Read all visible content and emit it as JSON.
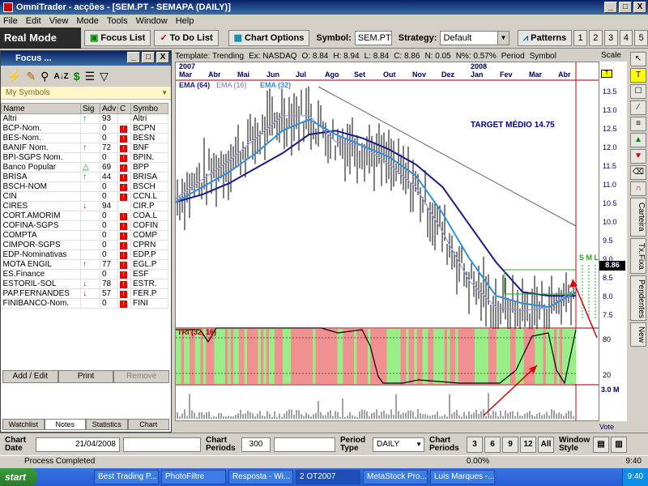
{
  "window": {
    "title": "OmniTrader - acções - [SEM.PT - SEMAPA (DAILY)]",
    "min": "_",
    "max": "□",
    "close": "X"
  },
  "menu": [
    "File",
    "Edit",
    "View",
    "Mode",
    "Tools",
    "Window",
    "Help"
  ],
  "toolbar": {
    "mode": "Real Mode",
    "focus_list": "Focus List",
    "todo_list": "To Do List",
    "chart_options": "Chart Options",
    "symbol_label": "Symbol:",
    "symbol_value": "SEM.PT",
    "strategy_label": "Strategy:",
    "strategy_value": "Default",
    "patterns": "Patterns",
    "pages": [
      "1",
      "2",
      "3",
      "4",
      "5"
    ]
  },
  "focus": {
    "title": "Focus ...",
    "list_name": "My Symbols",
    "columns": [
      "Name",
      "Sig",
      "Adv",
      "C",
      "Symbo"
    ],
    "rows": [
      {
        "name": "Altri",
        "sig": "up",
        "adv": "93",
        "c": "",
        "sym": "Altri"
      },
      {
        "name": "BCP-Nom.",
        "sig": "",
        "adv": "0",
        "c": "warn",
        "sym": "BCPN"
      },
      {
        "name": "BES-Nom.",
        "sig": "",
        "adv": "0",
        "c": "warn",
        "sym": "BESN"
      },
      {
        "name": "BANIF Nom.",
        "sig": "up",
        "adv": "72",
        "c": "warn",
        "sym": "BNF"
      },
      {
        "name": "BPI-SGPS Nom.",
        "sig": "",
        "adv": "0",
        "c": "warn",
        "sym": "BPIN."
      },
      {
        "name": "Banco Popular",
        "sig": "tri",
        "adv": "69",
        "c": "warn",
        "sym": "BPP"
      },
      {
        "name": "BRISA",
        "sig": "up",
        "adv": "44",
        "c": "warn",
        "sym": "BRISA"
      },
      {
        "name": "BSCH-NOM",
        "sig": "",
        "adv": "0",
        "c": "warn",
        "sym": "BSCH"
      },
      {
        "name": "CIN",
        "sig": "",
        "adv": "0",
        "c": "warn",
        "sym": "CCN.L"
      },
      {
        "name": "CIRES",
        "sig": "down",
        "adv": "94",
        "c": "",
        "sym": "CIR.P"
      },
      {
        "name": "CORT.AMORIM",
        "sig": "",
        "adv": "0",
        "c": "warn",
        "sym": "COA.L"
      },
      {
        "name": "COFINA-SGPS",
        "sig": "",
        "adv": "0",
        "c": "warn",
        "sym": "COFIN"
      },
      {
        "name": "COMPTA",
        "sig": "",
        "adv": "0",
        "c": "warn",
        "sym": "COMP"
      },
      {
        "name": "CIMPOR-SGPS",
        "sig": "",
        "adv": "0",
        "c": "warn",
        "sym": "CPRN"
      },
      {
        "name": "EDP-Nominativas",
        "sig": "",
        "adv": "0",
        "c": "warn",
        "sym": "EDP.P"
      },
      {
        "name": "MOTA ENGIL",
        "sig": "up",
        "adv": "77",
        "c": "warn",
        "sym": "EGL.P"
      },
      {
        "name": "ES.Finance",
        "sig": "",
        "adv": "0",
        "c": "warn",
        "sym": "ESF"
      },
      {
        "name": "ESTORIL-SOL",
        "sig": "down",
        "adv": "78",
        "c": "warn",
        "sym": "ESTR."
      },
      {
        "name": "PAP.FERNANDES",
        "sig": "down",
        "adv": "57",
        "c": "warn",
        "sym": "FER.P"
      },
      {
        "name": "FINIBANCO-Nom.",
        "sig": "",
        "adv": "0",
        "c": "warn",
        "sym": "FINI"
      }
    ],
    "buttons": [
      "Add / Edit",
      "Print",
      "Remove"
    ],
    "tabs": [
      "Watchlist",
      "Notes",
      "Statistics",
      "Chart"
    ]
  },
  "chart": {
    "header": {
      "template": "Template: Trending",
      "exchange": "Ex: NASDAQ",
      "o": "O: 8.84",
      "h": "H: 8.94",
      "l": "L: 8.84",
      "c": "C: 8.86",
      "n": "N: 0.05",
      "pct": "N%: 0.57%",
      "period": "Period",
      "symbol": "Symbol",
      "scale": "Scale"
    },
    "years": [
      "2007",
      "2008"
    ],
    "months": [
      "Mar",
      "Abr",
      "Mai",
      "Jun",
      "Jul",
      "Ago",
      "Set",
      "Out",
      "Nov",
      "Dez",
      "Jan",
      "Fev",
      "Mar",
      "Abr"
    ],
    "ema_labels": [
      "EMA (64)",
      "EMA (16)",
      "EMA (32)"
    ],
    "annotation": "TARGET MÉDIO 14.75",
    "sml": "S M L",
    "indicator_label": "TRI (32, 16)",
    "vote": "Vote",
    "last_price": "8.86"
  },
  "chart_data": {
    "type": "line",
    "title": "",
    "price_axis": [
      "13.5",
      "13.0",
      "12.5",
      "12.0",
      "11.5",
      "11.0",
      "10.5",
      "10.0",
      "9.5",
      "9.0",
      "8.5",
      "8.0",
      "7.5"
    ],
    "indicator_axis": [
      "80",
      "20"
    ],
    "volume_axis": "3.0 M",
    "series": [
      {
        "name": "EMA (64)",
        "color": "#1a1a8c",
        "values": [
          10.6,
          10.8,
          11.1,
          11.5,
          11.9,
          12.4,
          12.5,
          12.3,
          12.0,
          11.6,
          11.0,
          10.0,
          9.0,
          8.2,
          8.1,
          8.1
        ]
      },
      {
        "name": "EMA (16)",
        "color": "#9a9ad8",
        "values": [
          10.7,
          11.2,
          11.7,
          12.3,
          12.9,
          12.9,
          12.2,
          12.1,
          11.6,
          11.0,
          9.8,
          8.5,
          7.8,
          7.7,
          7.8,
          8.3
        ]
      },
      {
        "name": "EMA (32)",
        "color": "#3090e0",
        "values": [
          10.6,
          11.0,
          11.4,
          11.9,
          12.5,
          12.8,
          12.4,
          12.1,
          11.8,
          11.3,
          10.3,
          9.1,
          8.1,
          7.9,
          7.8,
          8.2
        ]
      }
    ]
  },
  "right_tools": {
    "tabs": [
      "Carteira",
      "Tx.Fixa",
      "Pendentes",
      "New"
    ]
  },
  "bottom": {
    "chart_date_label": "Chart Date",
    "chart_date_value": "21/04/2008",
    "chart_periods_label": "Chart Periods",
    "chart_periods_value": "300",
    "period_type_label": "Period Type",
    "period_type_value": "DAILY",
    "periods_label": "Chart Periods",
    "period_buttons": [
      "3",
      "6",
      "9",
      "12",
      "All"
    ],
    "window_style_label": "Window Style"
  },
  "status": {
    "text": "Process Completed",
    "pct": "0.00%",
    "time": "9:40"
  },
  "taskbar": {
    "start": "start",
    "tasks": [
      "Best Trading P...",
      "PhotoFiltre",
      "Resposta - Wi...",
      "2 OT2007",
      "MetaStock Pro...",
      "Luis Marques -..."
    ],
    "clock": "9:40"
  }
}
